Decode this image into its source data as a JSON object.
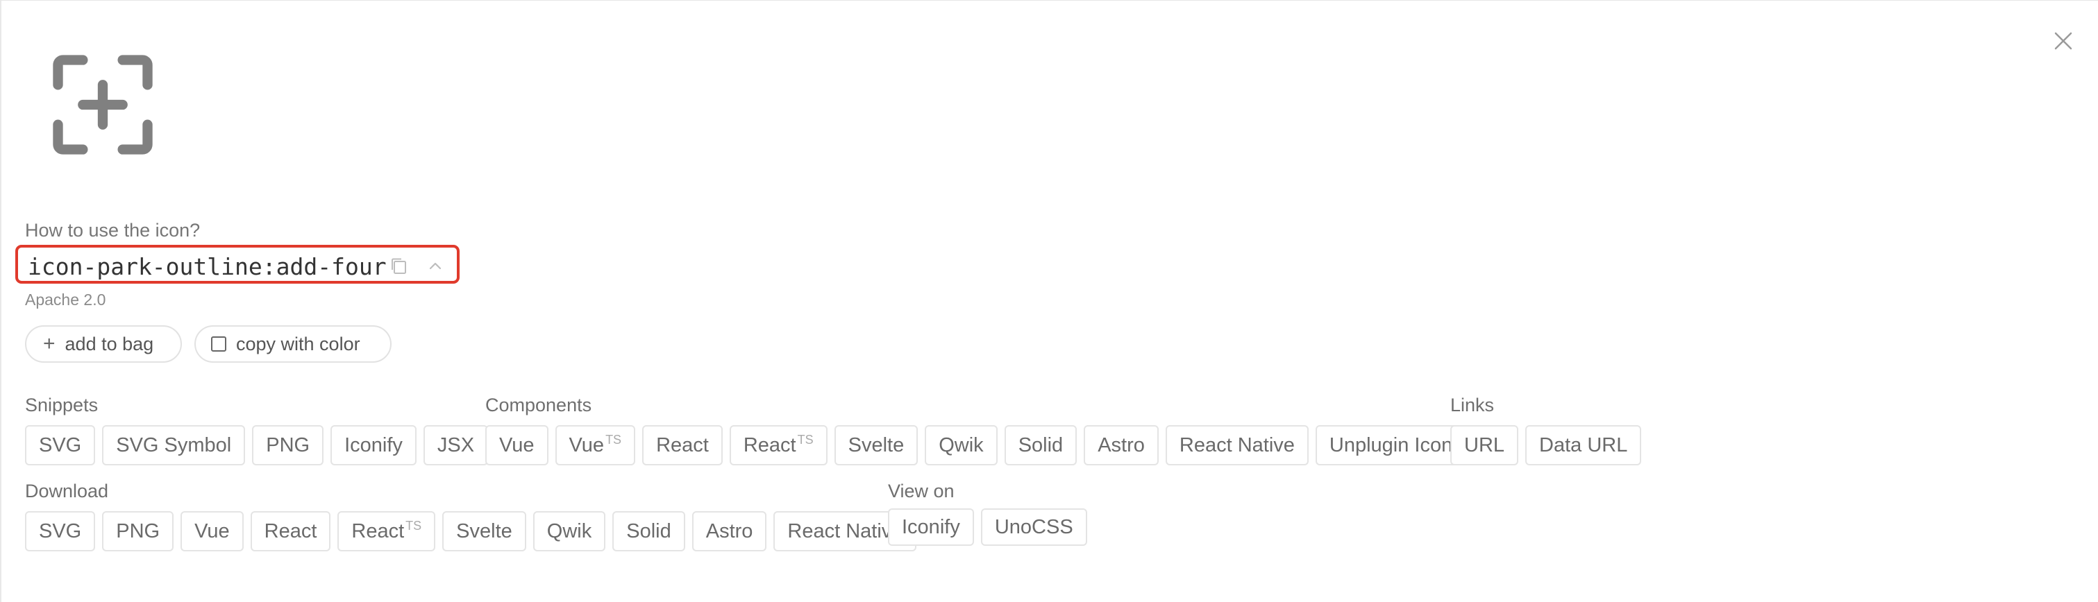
{
  "icon": {
    "id": "icon-park-outline:add-four",
    "question": "How to use the icon?",
    "license": "Apache 2.0"
  },
  "actions": {
    "add_to_bag": "add to bag",
    "copy_with_color": "copy with color"
  },
  "snippets": {
    "title": "Snippets",
    "items": [
      "SVG",
      "SVG Symbol",
      "PNG",
      "Iconify",
      "JSX"
    ]
  },
  "components": {
    "title": "Components",
    "items": [
      {
        "label": "Vue",
        "sup": ""
      },
      {
        "label": "Vue",
        "sup": "TS"
      },
      {
        "label": "React",
        "sup": ""
      },
      {
        "label": "React",
        "sup": "TS"
      },
      {
        "label": "Svelte",
        "sup": ""
      },
      {
        "label": "Qwik",
        "sup": ""
      },
      {
        "label": "Solid",
        "sup": ""
      },
      {
        "label": "Astro",
        "sup": ""
      },
      {
        "label": "React Native",
        "sup": ""
      },
      {
        "label": "Unplugin Icons",
        "sup": ""
      }
    ]
  },
  "links": {
    "title": "Links",
    "items": [
      "URL",
      "Data URL"
    ]
  },
  "download": {
    "title": "Download",
    "items": [
      {
        "label": "SVG",
        "sup": ""
      },
      {
        "label": "PNG",
        "sup": ""
      },
      {
        "label": "Vue",
        "sup": ""
      },
      {
        "label": "React",
        "sup": ""
      },
      {
        "label": "React",
        "sup": "TS"
      },
      {
        "label": "Svelte",
        "sup": ""
      },
      {
        "label": "Qwik",
        "sup": ""
      },
      {
        "label": "Solid",
        "sup": ""
      },
      {
        "label": "Astro",
        "sup": ""
      },
      {
        "label": "React Native",
        "sup": ""
      }
    ]
  },
  "view_on": {
    "title": "View on",
    "items": [
      "Iconify",
      "UnoCSS"
    ]
  },
  "icons": {
    "close": "close-icon",
    "preview": "add-four-icon",
    "copy": "copy-icon",
    "collapse": "chevron-up-icon",
    "plus": "plus-icon",
    "checkbox": "checkbox-icon"
  },
  "colors": {
    "highlight": "#e03a2c",
    "icon_gray": "#808080"
  }
}
